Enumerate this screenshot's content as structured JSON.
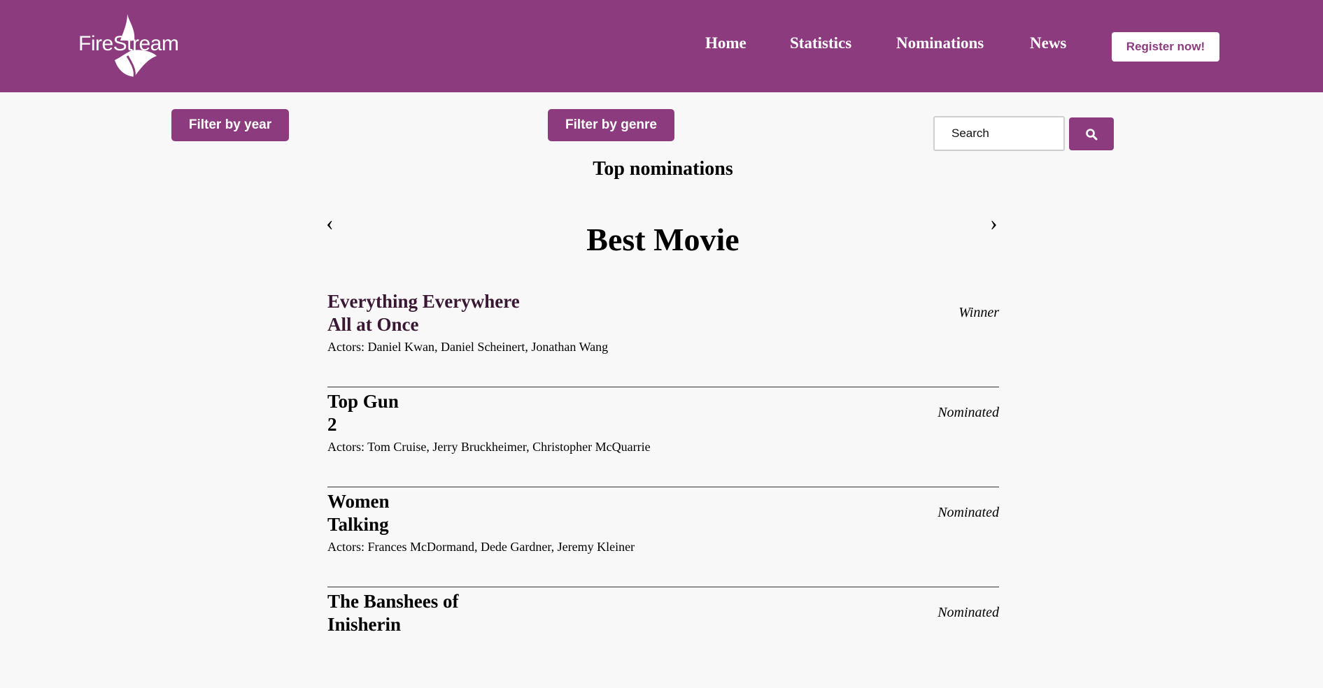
{
  "header": {
    "logo_text": "FireStream",
    "nav": [
      "Home",
      "Statistics",
      "Nominations",
      "News"
    ],
    "register_label": "Register now!"
  },
  "filters": {
    "year_label": "Filter by year",
    "genre_label": "Filter by genre"
  },
  "search": {
    "placeholder": "Search",
    "value": ""
  },
  "main": {
    "section_title": "Top nominations",
    "prev_arrow": "‹",
    "next_arrow": "›",
    "category_title": "Best Movie",
    "entries": [
      {
        "title": "Everything Everywhere\nAll at Once",
        "actors": "Actors: Daniel Kwan, Daniel Scheinert, Jonathan Wang",
        "status": "Winner"
      },
      {
        "title": "Top Gun\n2",
        "actors": "Actors: Tom Cruise, Jerry Bruckheimer, Christopher McQuarrie",
        "status": "Nominated"
      },
      {
        "title": "Women\nTalking",
        "actors": "Actors: Frances McDormand, Dede Gardner, Jeremy Kleiner",
        "status": "Nominated"
      },
      {
        "title": "The Banshees of\nInisherin",
        "actors": "",
        "status": "Nominated"
      }
    ]
  },
  "colors": {
    "brand": "#8c3c7e",
    "background": "#f8f8f8"
  }
}
